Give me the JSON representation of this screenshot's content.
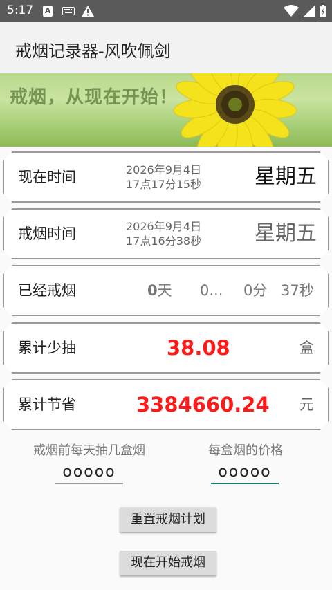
{
  "status_bar": {
    "time": "5:17",
    "icons": [
      "a-notification-icon",
      "keyboard-icon",
      "warning-icon",
      "wifi-icon",
      "signal-icon",
      "battery-icon"
    ]
  },
  "app_bar": {
    "title": "戒烟记录器-风吹佩剑"
  },
  "banner": {
    "text": "戒烟，从现在开始！"
  },
  "now_card": {
    "label": "现在时间",
    "date": "2026年9月4日",
    "time": "17点17分15秒",
    "weekday": "星期五"
  },
  "quit_card": {
    "label": "戒烟时间",
    "date": "2026年9月4日",
    "time": "17点16分38秒",
    "weekday": "星期五"
  },
  "duration_card": {
    "label": "已经戒烟",
    "days_value": "0",
    "days_unit": "天",
    "hours_text": "0...",
    "minutes_text": "0分",
    "seconds_text": "37秒"
  },
  "less_smoked_card": {
    "label": "累计少抽",
    "value": "38.08",
    "unit": "盒"
  },
  "saved_card": {
    "label": "累计节省",
    "value": "3384660.24",
    "unit": "元"
  },
  "inputs": {
    "boxes_per_day": {
      "label": "戒烟前每天抽几盒烟",
      "value": "ooooo"
    },
    "price_per_box": {
      "label": "每盒烟的价格",
      "value": "ooooo"
    }
  },
  "buttons": {
    "reset": "重置戒烟计划",
    "start": "现在开始戒烟"
  },
  "colors": {
    "highlight_red": "#ff1a1a",
    "accent_teal": "#1f7a6e",
    "status_bar": "#5a5a5a"
  }
}
